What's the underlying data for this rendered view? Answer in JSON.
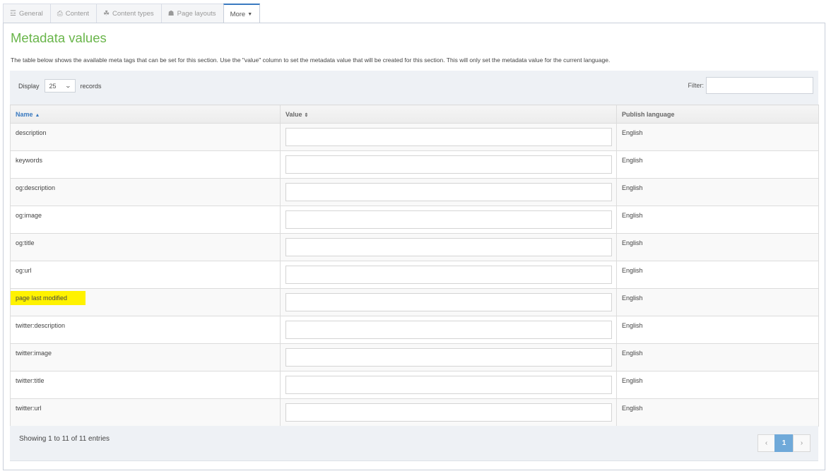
{
  "tabs": [
    {
      "label": "General",
      "icon": "sliders-icon",
      "glyph": "☲"
    },
    {
      "label": "Content",
      "icon": "document-icon",
      "glyph": "⎙"
    },
    {
      "label": "Content types",
      "icon": "cubes-icon",
      "glyph": "☘"
    },
    {
      "label": "Page layouts",
      "icon": "sitemap-icon",
      "glyph": "☗"
    },
    {
      "label": "More",
      "icon": "caret-down-icon",
      "glyph": "▼",
      "active": true
    }
  ],
  "page": {
    "title": "Metadata values",
    "description": "The table below shows the available meta tags that can be set for this section. Use the \"value\" column to set the metadata value that will be created for this section. This will only set the metadata value for the current language."
  },
  "toolbar": {
    "display_label": "Display",
    "page_size": "25",
    "records_label": "records",
    "filter_label": "Filter:",
    "filter_value": ""
  },
  "table": {
    "columns": [
      {
        "label": "Name",
        "sort": "▲"
      },
      {
        "label": "Value",
        "sort": "⇕"
      },
      {
        "label": "Publish language",
        "sort": ""
      }
    ],
    "highlight_color": "#fff200",
    "rows": [
      {
        "name": "description",
        "value": "",
        "language": "English"
      },
      {
        "name": "keywords",
        "value": "",
        "language": "English"
      },
      {
        "name": "og:description",
        "value": "",
        "language": "English"
      },
      {
        "name": "og:image",
        "value": "",
        "language": "English"
      },
      {
        "name": "og:title",
        "value": "",
        "language": "English"
      },
      {
        "name": "og:url",
        "value": "",
        "language": "English"
      },
      {
        "name": "page last modified",
        "value": "",
        "language": "English",
        "highlighted": true
      },
      {
        "name": "twitter:description",
        "value": "",
        "language": "English"
      },
      {
        "name": "twitter:image",
        "value": "",
        "language": "English"
      },
      {
        "name": "twitter:title",
        "value": "",
        "language": "English"
      },
      {
        "name": "twitter:url",
        "value": "",
        "language": "English"
      }
    ]
  },
  "footer": {
    "info": "Showing 1 to 11 of 11 entries",
    "pagination": {
      "prev": "‹",
      "current": "1",
      "next": "›"
    }
  },
  "colors": {
    "title_green": "#69b54a",
    "link_blue": "#3a7ac0",
    "active_page": "#6fa9d9"
  }
}
